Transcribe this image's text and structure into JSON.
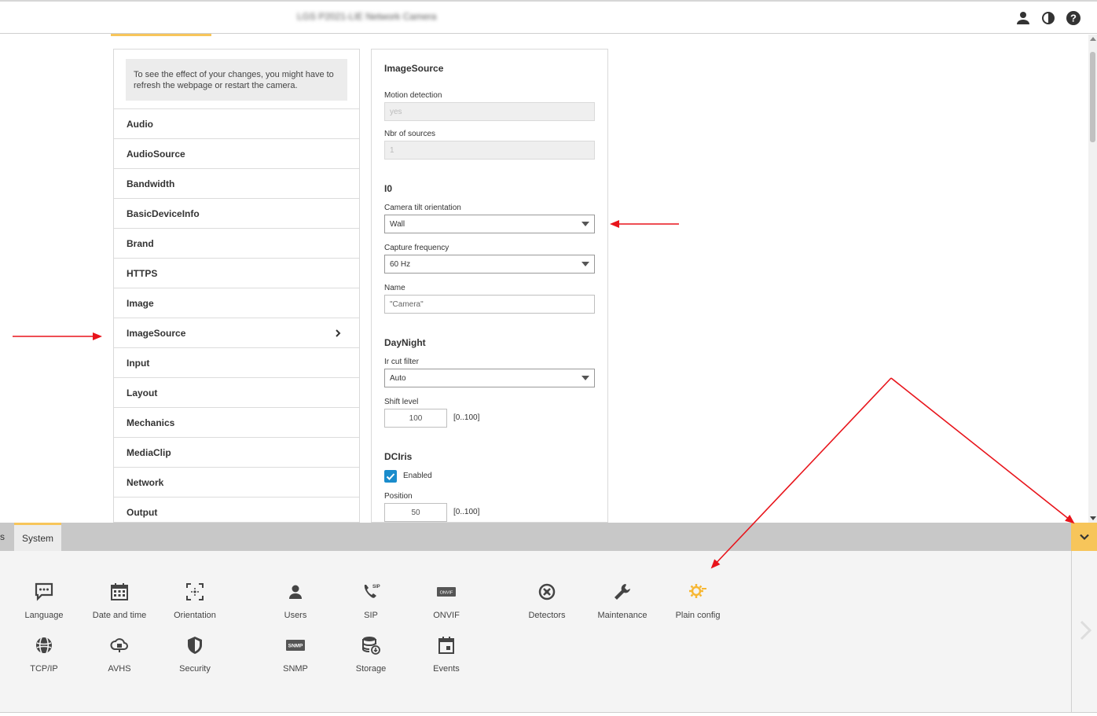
{
  "header": {
    "title": "LGS P2021-LIE Network Camera",
    "icons": [
      "user-icon",
      "contrast-icon",
      "help-icon"
    ]
  },
  "sidebar": {
    "notice": "To see the effect of your changes, you might have to refresh the webpage or restart the camera.",
    "items": [
      {
        "label": "Audio"
      },
      {
        "label": "AudioSource"
      },
      {
        "label": "Bandwidth"
      },
      {
        "label": "BasicDeviceInfo"
      },
      {
        "label": "Brand"
      },
      {
        "label": "HTTPS"
      },
      {
        "label": "Image"
      },
      {
        "label": "ImageSource",
        "selected": true
      },
      {
        "label": "Input"
      },
      {
        "label": "Layout"
      },
      {
        "label": "Mechanics"
      },
      {
        "label": "MediaClip"
      },
      {
        "label": "Network"
      },
      {
        "label": "Output"
      }
    ]
  },
  "form": {
    "section_imagesource": "ImageSource",
    "motion_detection_label": "Motion detection",
    "motion_detection_value": "yes",
    "nbr_sources_label": "Nbr of sources",
    "nbr_sources_value": "1",
    "section_i0": "I0",
    "tilt_label": "Camera tilt orientation",
    "tilt_value": "Wall",
    "capture_label": "Capture frequency",
    "capture_value": "60 Hz",
    "name_label": "Name",
    "name_value": "\"Camera\"",
    "section_daynight": "DayNight",
    "ircut_label": "Ir cut filter",
    "ircut_value": "Auto",
    "shift_label": "Shift level",
    "shift_value": "100",
    "shift_range": "[0..100]",
    "section_dciris": "DCIris",
    "enabled_label": "Enabled",
    "enabled_checked": true,
    "position_label": "Position",
    "position_value": "50",
    "position_range": "[0..100]"
  },
  "bottom_tabs": {
    "prev_tab_fragment": "s",
    "active_tab": "System"
  },
  "tools": {
    "language": "Language",
    "datetime": "Date and time",
    "orientation": "Orientation",
    "users": "Users",
    "sip": "SIP",
    "onvif": "ONVIF",
    "detectors": "Detectors",
    "maintenance": "Maintenance",
    "plainconfig": "Plain config",
    "tcpip": "TCP/IP",
    "avhs": "AVHS",
    "security": "Security",
    "snmp": "SNMP",
    "storage": "Storage",
    "events": "Events"
  },
  "colors": {
    "accent": "#f7c55a",
    "checkbox": "#1a8ccc",
    "annotation_arrow": "#e8141b"
  }
}
